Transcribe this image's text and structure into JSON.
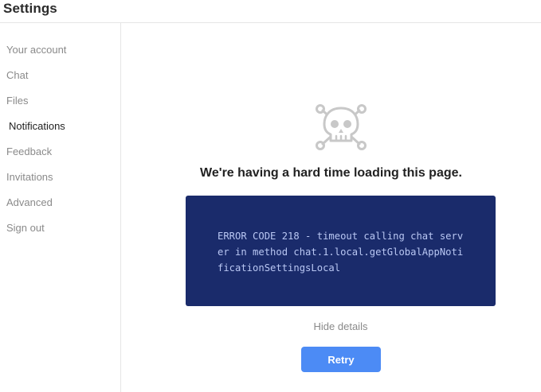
{
  "header": {
    "title": "Settings"
  },
  "sidebar": {
    "items": [
      {
        "label": "Your account"
      },
      {
        "label": "Chat"
      },
      {
        "label": "Files"
      },
      {
        "label": "Notifications",
        "selected": true
      },
      {
        "label": "Feedback"
      },
      {
        "label": "Invitations"
      },
      {
        "label": "Advanced"
      },
      {
        "label": "Sign out"
      }
    ]
  },
  "main": {
    "icon": "skull-crossbones-icon",
    "heading": "We're having a hard time loading this page.",
    "error_text": "ERROR CODE 218 - timeout calling chat server in method chat.1.local.getGlobalAppNotificationSettingsLocal",
    "hide_details_label": "Hide details",
    "retry_label": "Retry"
  },
  "colors": {
    "error_box_bg": "#1a2b6b",
    "error_text": "#b9c7f3",
    "retry_button": "#4c8bf5",
    "icon_gray": "#c8c8c8"
  }
}
